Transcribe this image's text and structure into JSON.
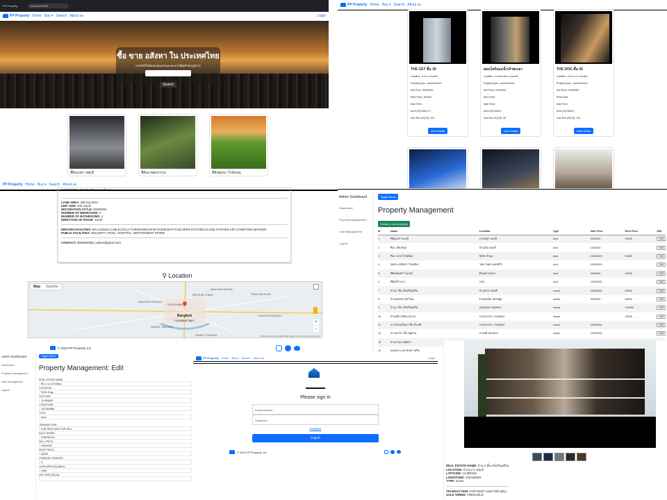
{
  "browser": {
    "url": "localhost:9090",
    "tab": "PP Property"
  },
  "brand": "PP Property",
  "nav": {
    "home": "Home",
    "buy": "Buy ▾",
    "search": "Search",
    "about": "About us",
    "login": "Login"
  },
  "hero": {
    "title": "ซื้อ ขาย อสังหา ใน ประเทศไทย",
    "subtitle": "หาทรัพย์ในฝันของคุณง่ายและสะดวกที่สุดทั่วทุกภูมิภาค",
    "search_button": "Search"
  },
  "home_cards": [
    {
      "title": "ที่ดินเปล่า ลพบุรี",
      "colors": [
        "#2b2a30",
        "#8a8d95",
        "#3a3a3a"
      ]
    },
    {
      "title": "ที่ดินเกษตรกรรม",
      "colors": [
        "#384a2c",
        "#6b8a40",
        "#1f2b1a"
      ]
    },
    {
      "title": "ที่ดินทุ่งนา ใกล้ถนน",
      "colors": [
        "#d8782a",
        "#5e9a2e",
        "#3a6d1c"
      ]
    }
  ],
  "listings": [
    {
      "title": "THE CET ชั้น 18",
      "location": "Location : สาทร กรุงเทพฯ",
      "type": "Property type : condominium",
      "sell": "Sell Price: 39000000",
      "rent": "Rent Price: 150000",
      "term": "Sale Term:",
      "area": "Area (SQ.WAH): 0",
      "unit": "Unit Size (SQ.M): 215",
      "button": "View Detail"
    },
    {
      "title": "คอนโดริมแม่น้ำเจ้าพระยา",
      "location": "Location : บางคอแหลม กรุงเทพฯ",
      "type": "Property type : condominium",
      "sell": "Sell Price: 47000000",
      "rent": "Rent Price:",
      "term": "Sale Term:",
      "area": "Area (SQ.WAH):",
      "unit": "Unit Size (SQ.M): 39",
      "button": "View Detail"
    },
    {
      "title": "THE DOG ชั้น 42",
      "location": "Location : ยานนาวา กรุงเทพฯ",
      "type": "Property type : condominium",
      "sell": "Sell Price: 19000000",
      "rent": "Rent Price:",
      "term": "Sale Term:",
      "area": "Area (SQ.WAH):",
      "unit": "Unit Size (SQ.M): 123",
      "button": "View Detail"
    }
  ],
  "detail": {
    "top_line": "CONDITION STANDARD: สภาพดีมาก",
    "rows": [
      {
        "label": "LAND AREA:",
        "value": " 300 SQ.WAH"
      },
      {
        "label": "UNIT SIZE:",
        "value": " 100 SQ.M"
      },
      {
        "label": "DECORATION STYLE:",
        "value": " MODERN"
      },
      {
        "label": "NUMBER OF BEDROOMS:",
        "value": " 4"
      },
      {
        "label": "NUMBER OF BATHROOMS:",
        "value": " 4"
      },
      {
        "label": "DIRECTION OF ROOM:",
        "value": " South"
      }
    ],
    "inroom_label": "INROOM FACILITIES:",
    "inroom_value": " BALCONIES,CABLE,FULLY FURNISHED,MAID ROOM,BATHTUB,OPEN KITCHEN,CLOSE KITCHEN,AIR CONDITION,WASHER",
    "public_label": "PUBLIC FACILITIES:",
    "public_value": " SECURITY, POOL, HOSPITAL, DEPARTMENT STORE",
    "contact_label": "CONTACT:",
    "contact_value": " 0853654885 | admin@gmail.com",
    "location_title": "Location",
    "map_tab_map": "Map",
    "map_tab_sat": "Satellite",
    "map_labels": [
      "NAKHON PATHOM",
      "Bangkok",
      "กรุงเทพมหานคร",
      "SAMUT SAKHON",
      "SAMUT PRAKAN",
      "CHACHOENGSAO",
      "PATHUM THANI",
      "PRACHIN BURI",
      "NAKHON NAYOK",
      "NONTHABURI"
    ],
    "map_footer": "Keyboard shortcuts   Map data ©2023 Google   Terms of Use   Report a map error",
    "copyright": "© 2023 PP Property, Inc"
  },
  "admin": {
    "title": "Admin Dashboard",
    "toggle": "Toggle Menu",
    "side": [
      "Dashboard",
      "Property Management",
      "User Management",
      "Logout"
    ],
    "heading": "Property Management",
    "create": "Create a new property",
    "columns": [
      "Id",
      "Name",
      "Location",
      "Type",
      "Sale Price",
      "Rent Price",
      "Edit"
    ],
    "rows": [
      [
        "1",
        "ที่ดินเปล่า ลพบุรี",
        "ลาดหญ้า ลพบุรี",
        "land",
        "5000000",
        "30000",
        "Edit"
      ],
      [
        "2",
        "ที่นา เชียงใหม่",
        "บ้านโฮ่ง ลพบุรี",
        "land",
        "1000000",
        "",
        "Edit"
      ],
      [
        "3",
        "ที่นา เขาย ใกล้เมือง",
        "ริมปิง ลำพูน",
        "land",
        "15000000",
        "50000",
        "Edit"
      ],
      [
        "4",
        "ขุยกระปุกสิงหา โกลเมือง",
        "วังตะวันตก นครศรีฯ",
        "land",
        "10000000",
        "",
        "Edit"
      ],
      [
        "5",
        "ที่ดินทองคำ ไบเกอร์",
        "ดีลออล์ สงขลา",
        "land",
        "9000000",
        "40000",
        "Edit"
      ],
      [
        "6",
        "ที่ดินใต้ ยะลา",
        "USA",
        "land",
        "24000000",
        "",
        "Edit"
      ],
      [
        "7",
        "บ้าน 2 ชั้น สไตล์โมเดิร์น",
        "บ้านกร่าง ชลบุรี",
        "house",
        "10000000",
        "80000",
        "Edit"
      ],
      [
        "8",
        "บ้านหลังกลางผ้าไหม",
        "ต.ทองหลิม นครปฐม",
        "house",
        "8900000",
        "65000",
        "Edit"
      ],
      [
        "9",
        "บ้าน 2 ชั้น สไตล์โมเดิร์น",
        "หนองจอก กรุงเทพฯ",
        "house",
        "",
        "100000",
        "Edit"
      ],
      [
        "10",
        "บ้านเดี่ยว ติดทะเลสาบ",
        "ลาดกระบัง 1 กรุงเทพฯ",
        "house",
        "",
        "30000",
        "Edit"
      ],
      [
        "11",
        "ทาวน์โฮมใหม่ 2 ชั้น ทำเลดี",
        "ลาดกระบัง 1 กรุงเทพฯ",
        "house",
        "15000000",
        "",
        "Edit"
      ],
      [
        "12",
        "ทาวเฮาส์ 2 ชั้น หมู่บ้าน",
        "บางพลี กรุงเทพฯ",
        "house",
        "12000000",
        "",
        "Edit"
      ],
      [
        "13",
        "บ้านภาพงามนิทรา",
        "",
        "",
        "",
        "",
        "Edit"
      ],
      [
        "14",
        "คอนโด LOW RISE ร่มรื่น",
        "",
        "",
        "",
        "",
        "Edit"
      ]
    ]
  },
  "edit": {
    "title": "Admin Dashboard",
    "toggle": "Toggle Menu",
    "side": [
      "Dashboard",
      "Property management",
      "User management",
      "Logout"
    ],
    "heading": "Property Management: Edit",
    "fields": [
      {
        "label": "REAL ESTATE NAME:",
        "value": "ที่นา เขาย ใกล้เมือง"
      },
      {
        "label": "LOCATION:",
        "value": "ริมปิง ลำพูน"
      },
      {
        "label": "LATITUDE:",
        "value": "13.490828"
      },
      {
        "label": "LONGITUDE:",
        "value": "100.664888"
      },
      {
        "label": "TYPE:",
        "value": "land"
      },
      {
        "label": "TRANSACTION:",
        "value": "FOR RENT AND FOR SELL"
      },
      {
        "label": "SALE TERMS:",
        "value": "FREEHOLD"
      },
      {
        "label": "SELL PRICE:",
        "value": "15000000"
      },
      {
        "label": "RENT PRICE:",
        "value": "50000"
      },
      {
        "label": "COMMON CHARGES:",
        "value": "0"
      },
      {
        "label": "LAND AREA (SQ.WAH):",
        "value": "1088"
      },
      {
        "label": "UNIT SIZE (SQ.M):",
        "value": ""
      }
    ]
  },
  "signin": {
    "heading": "Please sign in",
    "email_ph": "Email address",
    "password_ph": "Password",
    "register": "Register",
    "button": "Log in",
    "copyright": "© 2023 PP Property, Inc"
  },
  "house": {
    "lines": [
      {
        "label": "REAL ESTATE NAME:",
        "value": " บ้าน 2 ชั้น สไตล์โมเดิร์น"
      },
      {
        "label": "LOCATION:",
        "value": " บ้านกร่าง ชลบุรี"
      },
      {
        "label": "LATITUDE:",
        "value": " 13.898152"
      },
      {
        "label": "LONGITUDE:",
        "value": " 100.546004"
      },
      {
        "label": "TYPE:",
        "value": " house"
      }
    ],
    "lines2": [
      {
        "label": "TRANSACTION:",
        "value": " FOR RENT AND FOR SELL"
      },
      {
        "label": "SALE TERMS:",
        "value": " FREEHOLD"
      }
    ]
  },
  "colors": {
    "primary": "#0d6efd",
    "success": "#198754",
    "dark": "#212529"
  }
}
